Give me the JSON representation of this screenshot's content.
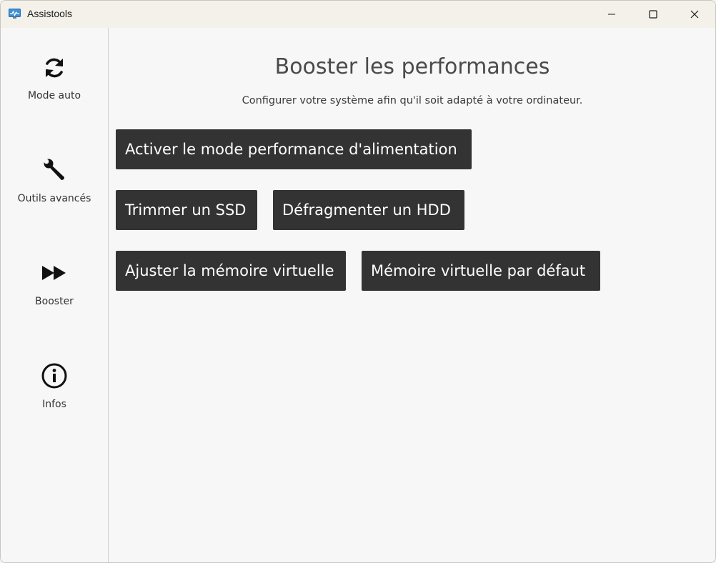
{
  "window": {
    "title": "Assistools",
    "controls": {
      "minimize_icon": "minimize-icon",
      "maximize_icon": "maximize-icon",
      "close_icon": "close-icon"
    }
  },
  "sidebar": {
    "items": [
      {
        "label": "Mode auto",
        "icon": "refresh-icon"
      },
      {
        "label": "Outils avancés",
        "icon": "wrench-icon"
      },
      {
        "label": "Booster",
        "icon": "fast-forward-icon"
      },
      {
        "label": "Infos",
        "icon": "info-icon"
      }
    ]
  },
  "main": {
    "title": "Booster les performances",
    "subtitle": "Configurer votre système afin qu'il soit adapté à votre ordinateur.",
    "buttons": {
      "power_mode": "Activer le mode performance d'alimentation",
      "trim_ssd": "Trimmer un SSD",
      "defrag_hdd": "Défragmenter un HDD",
      "adjust_vmem": "Ajuster la mémoire virtuelle",
      "default_vmem": "Mémoire virtuelle par défaut"
    }
  },
  "colors": {
    "button_bg": "#333333",
    "button_text": "#ffffff",
    "background": "#f7f7f7",
    "title_text": "#4a4a4a"
  }
}
